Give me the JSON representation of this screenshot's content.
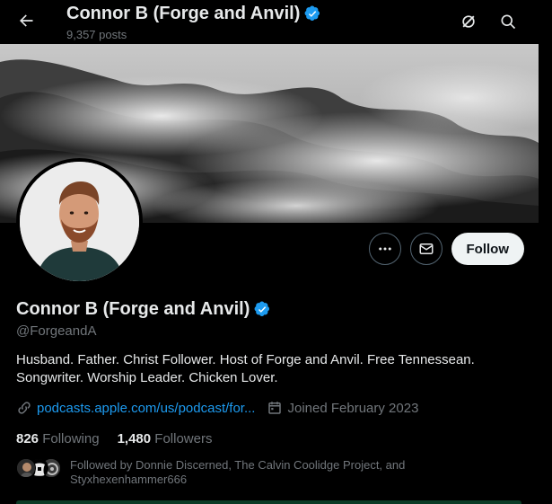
{
  "header": {
    "title": "Connor B (Forge and Anvil)",
    "posts": "9,357 posts"
  },
  "profile": {
    "name": "Connor B (Forge and Anvil)",
    "handle": "@ForgeandA",
    "bio_line1": "Husband. Father. Christ Follower. Host of Forge and Anvil. Free Tennessean.",
    "bio_line2": "Songwriter. Worship Leader. Chicken Lover.",
    "link": "podcasts.apple.com/us/podcast/for...",
    "joined": "Joined February 2023",
    "following_count": "826",
    "following_label": "Following",
    "followers_count": "1,480",
    "followers_label": "Followers",
    "followed_by_line1": "Followed by Donnie Discerned, The Calvin Coolidge Project, and",
    "followed_by_line2": "Styxhexenhammer666"
  },
  "actions": {
    "follow_label": "Follow"
  },
  "colors": {
    "accent": "#1d9bf0",
    "background": "#000000",
    "muted": "#71767b",
    "verified": "#1d9bf0"
  },
  "icons": [
    "back-arrow-icon",
    "grok-icon",
    "search-icon",
    "more-icon",
    "message-icon",
    "link-icon",
    "calendar-icon",
    "verified-badge-icon"
  ]
}
